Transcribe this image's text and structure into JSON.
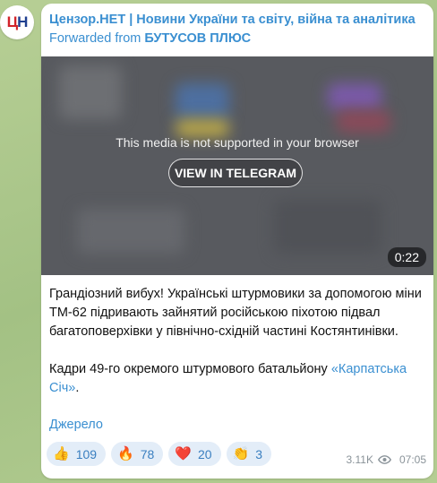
{
  "avatar": {
    "text_1": "Ц",
    "text_2": "Н"
  },
  "header": {
    "channel_title": "Цензор.НЕТ | Новини України та світу, війна та аналітика",
    "forwarded_prefix": "Forwarded from ",
    "forwarded_source": "БУТУСОВ ПЛЮС"
  },
  "media": {
    "message": "This media is not supported in your browser",
    "button_label": "VIEW IN TELEGRAM",
    "duration": "0:22"
  },
  "post": {
    "paragraph_1": "Грандіозний вибух! Українські штурмовики за допомогою міни ТМ-62 підривають зайнятий російською піхотою підвал багатоповерхівки у північно-східній частині Костянтинівки.",
    "paragraph_2_prefix": "Кадри 49-го окремого штурмового батальйону ",
    "paragraph_2_link": "«Карпатська Січ»",
    "paragraph_2_suffix": ".",
    "source_link": "Джерело"
  },
  "reactions": [
    {
      "icon": "thumbs-up-icon",
      "emoji": "👍",
      "count": "109"
    },
    {
      "icon": "fire-icon",
      "emoji": "🔥",
      "count": "78"
    },
    {
      "icon": "heart-icon",
      "emoji": "❤️",
      "count": "20"
    },
    {
      "icon": "clap-icon",
      "emoji": "👏",
      "count": "3"
    }
  ],
  "meta": {
    "views": "3.11K",
    "time": "07:05"
  },
  "colors": {
    "link": "#3a8fd1",
    "reaction_bg": "#e3edf8",
    "chat_bg": "#a9c58c"
  }
}
